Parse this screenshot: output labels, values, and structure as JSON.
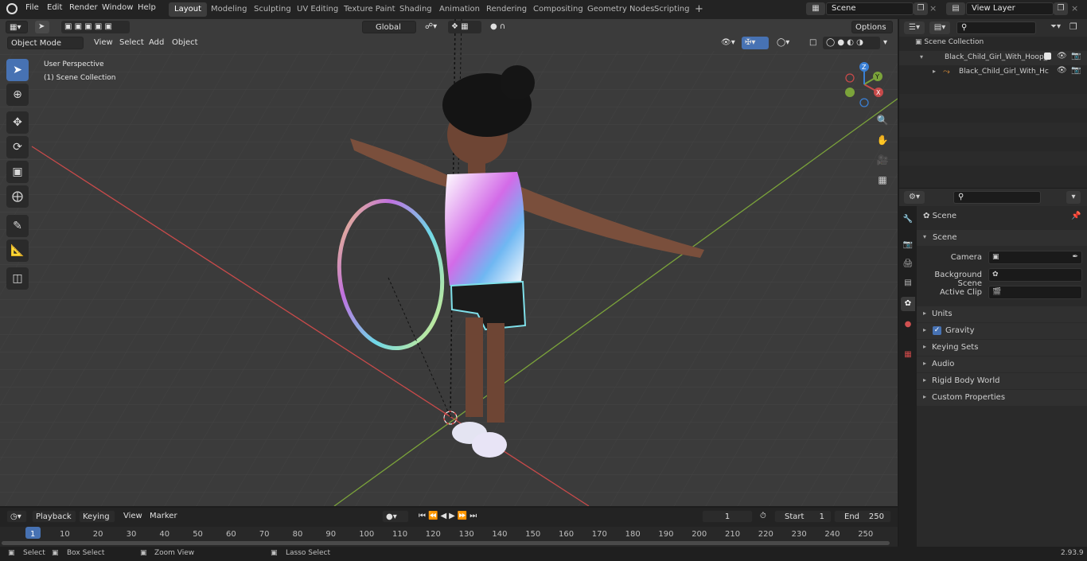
{
  "menu": [
    "File",
    "Edit",
    "Render",
    "Window",
    "Help"
  ],
  "workspaces": [
    {
      "label": "Layout",
      "active": true
    },
    {
      "label": "Modeling"
    },
    {
      "label": "Sculpting"
    },
    {
      "label": "UV Editing"
    },
    {
      "label": "Texture Paint"
    },
    {
      "label": "Shading"
    },
    {
      "label": "Animation"
    },
    {
      "label": "Rendering"
    },
    {
      "label": "Compositing"
    },
    {
      "label": "Geometry Nodes"
    },
    {
      "label": "Scripting"
    }
  ],
  "scene_field": "Scene",
  "view_layer_field": "View Layer",
  "viewport": {
    "mode": "Object Mode",
    "header_menus": [
      "View",
      "Select",
      "Add",
      "Object"
    ],
    "transform_orientation": "Global",
    "options_label": "Options",
    "perspective_label": "User Perspective",
    "collection_label": "(1) Scene Collection",
    "gizmo": {
      "x": "X",
      "y": "Y",
      "z": "Z"
    }
  },
  "outliner": {
    "root": "Scene Collection",
    "items": [
      {
        "label": "Black_Child_Girl_With_Hoop_1"
      },
      {
        "label": "Black_Child_Girl_With_Hc"
      }
    ]
  },
  "properties": {
    "header_title": "Scene",
    "panel_title": "Scene",
    "fields": [
      {
        "label": "Camera",
        "value": ""
      },
      {
        "label": "Background Scene",
        "value": ""
      },
      {
        "label": "Active Clip",
        "value": ""
      }
    ],
    "sections": [
      "Units",
      "Gravity",
      "Keying Sets",
      "Audio",
      "Rigid Body World",
      "Custom Properties"
    ],
    "gravity_checked": true
  },
  "timeline": {
    "menus": [
      "Playback",
      "Keying",
      "View",
      "Marker"
    ],
    "current_frame": "1",
    "start_label": "Start",
    "start_value": "1",
    "end_label": "End",
    "end_value": "250",
    "ticks": [
      "1",
      "10",
      "20",
      "30",
      "40",
      "50",
      "60",
      "70",
      "80",
      "90",
      "100",
      "110",
      "120",
      "130",
      "140",
      "150",
      "160",
      "170",
      "180",
      "190",
      "200",
      "210",
      "220",
      "230",
      "240",
      "250"
    ]
  },
  "status": {
    "items": [
      "Select",
      "Box Select",
      "Zoom View",
      "Lasso Select"
    ],
    "version": "2.93.9"
  },
  "colors": {
    "accent": "#4772b3",
    "x_axis": "#c74a4a",
    "y_axis": "#7ba33a",
    "z_axis": "#3a7fd4"
  }
}
